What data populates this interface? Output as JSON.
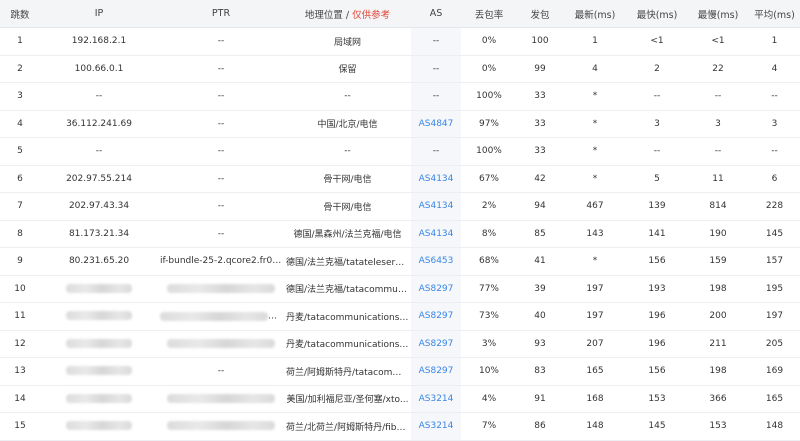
{
  "headers": {
    "hop": "跳数",
    "ip": "IP",
    "ptr": "PTR",
    "geo": "地理位置 / ",
    "geo_note": "仅供参考",
    "as": "AS",
    "loss": "丢包率",
    "sent": "发包",
    "last": "最新(ms)",
    "best": "最快(ms)",
    "worst": "最慢(ms)",
    "avg": "平均(ms)"
  },
  "rows": [
    {
      "hop": "1",
      "ip": "192.168.2.1",
      "ptr": "--",
      "geo": "局域网",
      "as": "--",
      "as_link": false,
      "loss": "0%",
      "sent": "100",
      "last": "1",
      "best": "<1",
      "worst": "<1",
      "avg": "1"
    },
    {
      "hop": "2",
      "ip": "100.66.0.1",
      "ptr": "--",
      "geo": "保留",
      "as": "--",
      "as_link": false,
      "loss": "0%",
      "sent": "99",
      "last": "4",
      "best": "2",
      "worst": "22",
      "avg": "4"
    },
    {
      "hop": "3",
      "ip": "--",
      "ptr": "--",
      "geo": "--",
      "as": "--",
      "as_link": false,
      "loss": "100%",
      "sent": "33",
      "last": "*",
      "best": "--",
      "worst": "--",
      "avg": "--"
    },
    {
      "hop": "4",
      "ip": "36.112.241.69",
      "ptr": "--",
      "geo": "中国/北京/电信",
      "as": "AS4847",
      "as_link": true,
      "loss": "97%",
      "sent": "33",
      "last": "*",
      "best": "3",
      "worst": "3",
      "avg": "3"
    },
    {
      "hop": "5",
      "ip": "--",
      "ptr": "--",
      "geo": "--",
      "as": "--",
      "as_link": false,
      "loss": "100%",
      "sent": "33",
      "last": "*",
      "best": "--",
      "worst": "--",
      "avg": "--"
    },
    {
      "hop": "6",
      "ip": "202.97.55.214",
      "ptr": "--",
      "geo": "骨干网/电信",
      "as": "AS4134",
      "as_link": true,
      "loss": "67%",
      "sent": "42",
      "last": "*",
      "best": "5",
      "worst": "11",
      "avg": "6"
    },
    {
      "hop": "7",
      "ip": "202.97.43.34",
      "ptr": "--",
      "geo": "骨干网/电信",
      "as": "AS4134",
      "as_link": true,
      "loss": "2%",
      "sent": "94",
      "last": "467",
      "best": "139",
      "worst": "814",
      "avg": "228"
    },
    {
      "hop": "8",
      "ip": "81.173.21.34",
      "ptr": "--",
      "geo": "德国/黑森州/法兰克福/电信",
      "as": "AS4134",
      "as_link": true,
      "loss": "8%",
      "sent": "85",
      "last": "143",
      "best": "141",
      "worst": "190",
      "avg": "145"
    },
    {
      "hop": "9",
      "ip": "80.231.65.20",
      "ptr": "if-bundle-25-2.qcore2.fr0-fr...",
      "geo": "德国/法兰克福/tatateleservice...",
      "as": "AS6453",
      "as_link": true,
      "loss": "68%",
      "sent": "41",
      "last": "*",
      "best": "156",
      "worst": "159",
      "avg": "157"
    },
    {
      "hop": "10",
      "ip": "",
      "ip_blur": true,
      "ptr": "",
      "ptr_blur": true,
      "ptr_tail": "",
      "geo": "德国/法兰克福/tatacommunicat...",
      "as": "AS8297",
      "as_link": true,
      "loss": "77%",
      "sent": "39",
      "last": "197",
      "best": "193",
      "worst": "198",
      "avg": "195"
    },
    {
      "hop": "11",
      "ip": "",
      "ip_blur": true,
      "ptr": "",
      "ptr_blur": true,
      "ptr_tail": "a...",
      "geo": "丹麦/tatacommunications.com",
      "as": "AS8297",
      "as_link": true,
      "loss": "73%",
      "sent": "40",
      "last": "197",
      "best": "196",
      "worst": "200",
      "avg": "197"
    },
    {
      "hop": "12",
      "ip": "",
      "ip_blur": true,
      "ptr": "",
      "ptr_blur": true,
      "ptr_tail": "",
      "geo": "丹麦/tatacommunications.com",
      "as": "AS8297",
      "as_link": true,
      "loss": "3%",
      "sent": "93",
      "last": "207",
      "best": "196",
      "worst": "211",
      "avg": "205"
    },
    {
      "hop": "13",
      "ip": "",
      "ip_blur": true,
      "ptr": "--",
      "geo": "荷兰/阿姆斯特丹/tatacommun...",
      "as": "AS8297",
      "as_link": true,
      "loss": "10%",
      "sent": "83",
      "last": "165",
      "best": "156",
      "worst": "198",
      "avg": "169"
    },
    {
      "hop": "14",
      "ip": "",
      "ip_blur": true,
      "ptr": "",
      "ptr_blur": true,
      "ptr_tail": "",
      "geo": "美国/加利福尼亚/圣何塞/xto...",
      "as": "AS3214",
      "as_link": true,
      "loss": "4%",
      "sent": "91",
      "last": "168",
      "best": "153",
      "worst": "366",
      "avg": "165"
    },
    {
      "hop": "15",
      "ip": "",
      "ip_blur": true,
      "ptr": "",
      "ptr_blur": true,
      "ptr_tail": "",
      "geo": "荷兰/北荷兰/阿姆斯特丹/fiber...",
      "as": "AS3214",
      "as_link": true,
      "loss": "7%",
      "sent": "86",
      "last": "148",
      "best": "145",
      "worst": "153",
      "avg": "148"
    }
  ]
}
